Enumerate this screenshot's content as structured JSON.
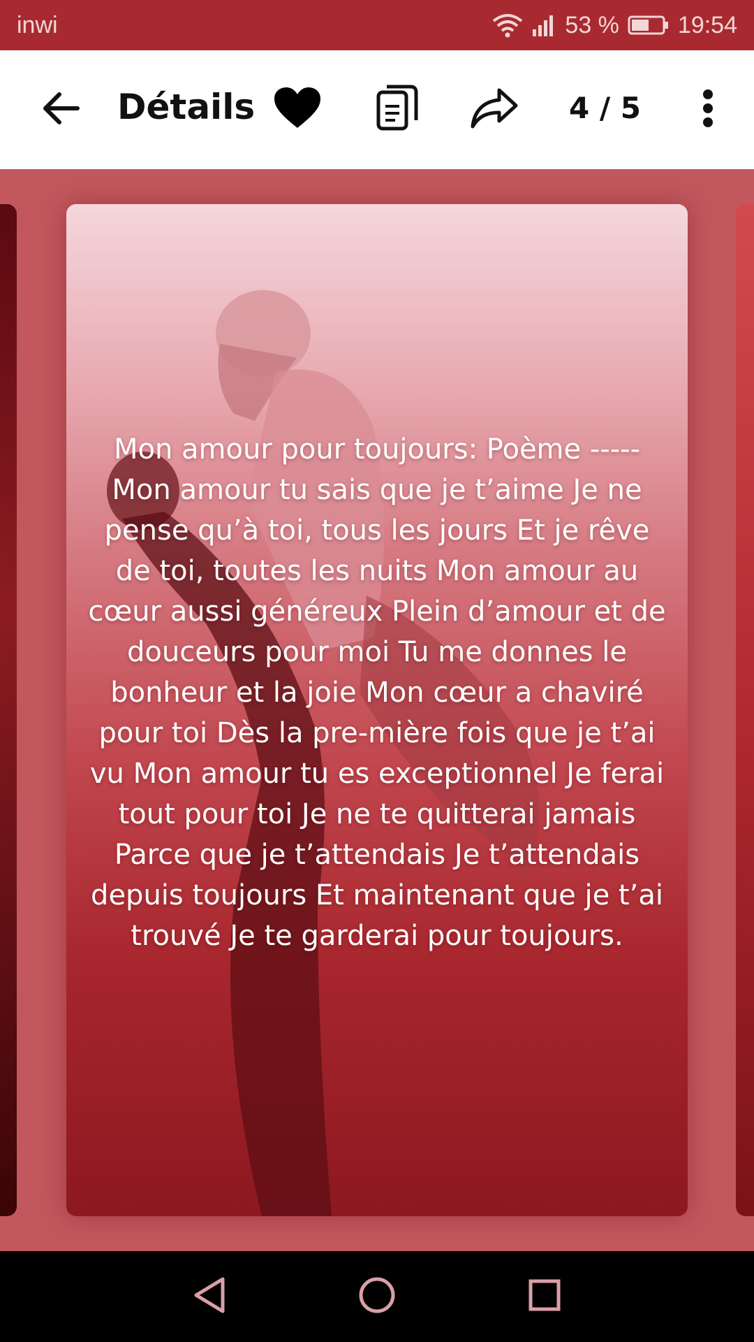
{
  "status_bar": {
    "carrier": "inwi",
    "battery_percent": "53 %",
    "time": "19:54"
  },
  "toolbar": {
    "title": "Détails",
    "counter": "4 / 5",
    "icons": [
      "back-arrow-icon",
      "heart-icon",
      "copy-icon",
      "share-icon",
      "more-vert-icon"
    ]
  },
  "card": {
    "poem": "Mon amour pour toujours: Poème ----- Mon amour tu sais que je t’aime Je ne pense qu’à toi, tous les jours Et je rêve de toi, toutes les nuits Mon amour au cœur aussi généreux Plein d’amour et de douceurs pour moi Tu me donnes le bonheur et la joie Mon cœur a chaviré pour toi Dès la pre-mière fois que je t’ai vu Mon amour tu es exceptionnel Je ferai tout pour toi Je ne te quitterai jamais Parce que je t’attendais Je t’attendais depuis toujours Et maintenant que je t’ai trouvé Je te garderai pour toujours."
  },
  "nav_bar": {
    "icons": [
      "back-triangle-icon",
      "home-circle-icon",
      "recents-square-icon"
    ]
  },
  "colors": {
    "status_bar": "#a82a30",
    "content_bg": "#c2585e",
    "toolbar_bg": "#ffffff",
    "nav_icon": "#d9a0a8"
  }
}
